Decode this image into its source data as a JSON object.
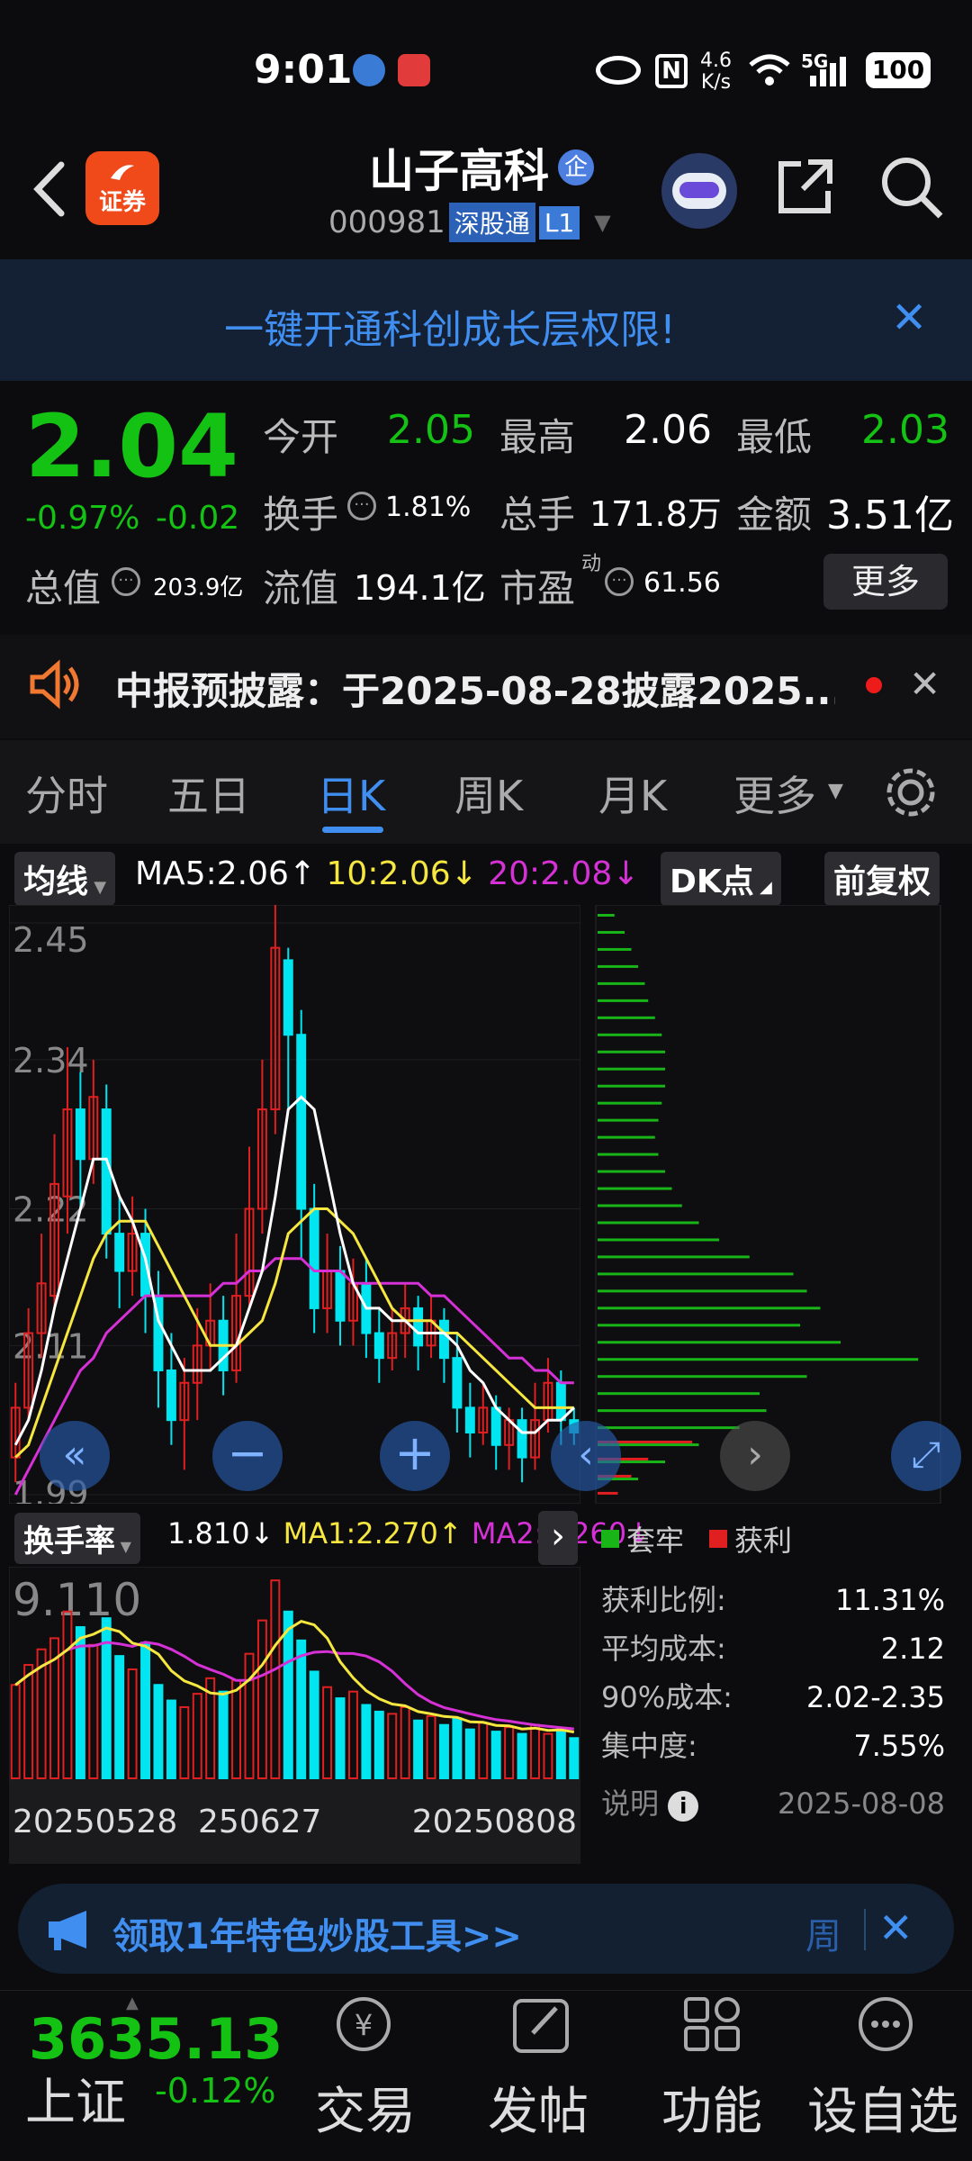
{
  "status": {
    "time": "9:01",
    "net_speed_top": "4.6",
    "net_speed_unit": "K/s",
    "battery": "100",
    "signal_label": "5G"
  },
  "header": {
    "back_icon": "chevron-left-icon",
    "app_logo_text": "证券",
    "stock_name": "山子高科",
    "enterprise_badge": "企",
    "stock_code": "000981",
    "market_tag": "深股通",
    "level_tag": "L1",
    "share_icon": "share-icon",
    "search_icon": "search-icon"
  },
  "banner": {
    "text": "一键开通科创成长层权限!",
    "close": "✕"
  },
  "quote": {
    "price": "2.04",
    "change_pct": "-0.97%",
    "change": "-0.02",
    "open_label": "今开",
    "open": "2.05",
    "high_label": "最高",
    "high": "2.06",
    "low_label": "最低",
    "low": "2.03",
    "turnover_label": "换手",
    "turnover": "1.81%",
    "volume_label": "总手",
    "volume": "171.8万",
    "amount_label": "金额",
    "amount": "3.51亿",
    "mktcap_label": "总值",
    "mktcap": "203.9亿",
    "float_label": "流值",
    "float_cap": "194.1亿",
    "pe_label": "市盈",
    "pe_sup": "动",
    "pe": "61.56",
    "more": "更多"
  },
  "notice": {
    "text": "中报预披露：于2025-08-28披露2025...",
    "close": "✕"
  },
  "tabs": [
    {
      "label": "分时"
    },
    {
      "label": "五日"
    },
    {
      "label": "日K",
      "active": true
    },
    {
      "label": "周K"
    },
    {
      "label": "月K"
    },
    {
      "label": "更多"
    }
  ],
  "chart_toolbar": {
    "ma_select": "均线",
    "ma5": "MA5:2.06",
    "ma5_arrow": "↑",
    "ma10": "10:2.06",
    "ma10_arrow": "↓",
    "ma20": "20:2.08",
    "ma20_arrow": "↓",
    "dk": "DK点",
    "adjust": "前复权"
  },
  "colors": {
    "up": "#e02020",
    "down": "#00e5f0",
    "ma5": "#ffffff",
    "ma10": "#f5e640",
    "ma20": "#d631d6",
    "green": "#14c214"
  },
  "chart_data": {
    "type": "candlestick",
    "y_ticks": [
      "2.45",
      "2.34",
      "2.22",
      "2.11",
      "1.99"
    ],
    "ylim": [
      1.99,
      2.45
    ],
    "x_ticks": [
      "20250528",
      "250627",
      "20250808"
    ],
    "candles": [
      [
        2.02,
        2.06,
        2.08,
        2.0
      ],
      [
        2.06,
        2.12,
        2.14,
        2.05
      ],
      [
        2.12,
        2.16,
        2.2,
        2.1
      ],
      [
        2.15,
        2.24,
        2.28,
        2.14
      ],
      [
        2.23,
        2.3,
        2.35,
        2.2
      ],
      [
        2.3,
        2.26,
        2.33,
        2.22
      ],
      [
        2.26,
        2.31,
        2.34,
        2.24
      ],
      [
        2.3,
        2.2,
        2.32,
        2.18
      ],
      [
        2.2,
        2.17,
        2.23,
        2.14
      ],
      [
        2.17,
        2.2,
        2.23,
        2.15
      ],
      [
        2.2,
        2.15,
        2.22,
        2.12
      ],
      [
        2.15,
        2.09,
        2.17,
        2.06
      ],
      [
        2.09,
        2.05,
        2.12,
        2.03
      ],
      [
        2.05,
        2.08,
        2.1,
        2.01
      ],
      [
        2.08,
        2.11,
        2.14,
        2.05
      ],
      [
        2.11,
        2.13,
        2.16,
        2.09
      ],
      [
        2.13,
        2.09,
        2.15,
        2.07
      ],
      [
        2.09,
        2.15,
        2.2,
        2.08
      ],
      [
        2.15,
        2.22,
        2.27,
        2.14
      ],
      [
        2.22,
        2.3,
        2.34,
        2.2
      ],
      [
        2.3,
        2.43,
        2.47,
        2.28
      ],
      [
        2.42,
        2.36,
        2.43,
        2.3
      ],
      [
        2.36,
        2.22,
        2.38,
        2.18
      ],
      [
        2.22,
        2.14,
        2.24,
        2.12
      ],
      [
        2.14,
        2.17,
        2.2,
        2.12
      ],
      [
        2.17,
        2.13,
        2.19,
        2.11
      ],
      [
        2.13,
        2.16,
        2.18,
        2.11
      ],
      [
        2.16,
        2.12,
        2.18,
        2.1
      ],
      [
        2.12,
        2.1,
        2.14,
        2.08
      ],
      [
        2.1,
        2.12,
        2.14,
        2.09
      ],
      [
        2.12,
        2.14,
        2.16,
        2.1
      ],
      [
        2.14,
        2.11,
        2.15,
        2.09
      ],
      [
        2.11,
        2.13,
        2.15,
        2.1
      ],
      [
        2.13,
        2.1,
        2.14,
        2.08
      ],
      [
        2.1,
        2.06,
        2.12,
        2.04
      ],
      [
        2.06,
        2.04,
        2.08,
        2.02
      ],
      [
        2.04,
        2.06,
        2.08,
        2.03
      ],
      [
        2.06,
        2.03,
        2.07,
        2.01
      ],
      [
        2.03,
        2.05,
        2.06,
        2.01
      ],
      [
        2.05,
        2.02,
        2.06,
        2.0
      ],
      [
        2.02,
        2.05,
        2.08,
        2.01
      ],
      [
        2.05,
        2.08,
        2.1,
        2.04
      ],
      [
        2.08,
        2.05,
        2.09,
        2.03
      ],
      [
        2.05,
        2.04,
        2.06,
        2.03
      ]
    ],
    "ma5": [
      2.03,
      2.05,
      2.09,
      2.14,
      2.18,
      2.22,
      2.26,
      2.26,
      2.23,
      2.21,
      2.18,
      2.13,
      2.11,
      2.09,
      2.09,
      2.09,
      2.1,
      2.11,
      2.14,
      2.17,
      2.23,
      2.3,
      2.31,
      2.3,
      2.25,
      2.2,
      2.16,
      2.14,
      2.14,
      2.13,
      2.13,
      2.12,
      2.12,
      2.12,
      2.11,
      2.09,
      2.08,
      2.06,
      2.05,
      2.04,
      2.04,
      2.05,
      2.05,
      2.06
    ],
    "ma10": [
      2.02,
      2.03,
      2.06,
      2.09,
      2.12,
      2.15,
      2.18,
      2.2,
      2.21,
      2.21,
      2.21,
      2.19,
      2.17,
      2.15,
      2.13,
      2.11,
      2.11,
      2.11,
      2.12,
      2.13,
      2.16,
      2.2,
      2.21,
      2.22,
      2.22,
      2.21,
      2.2,
      2.18,
      2.16,
      2.14,
      2.13,
      2.13,
      2.13,
      2.12,
      2.12,
      2.11,
      2.1,
      2.09,
      2.08,
      2.07,
      2.06,
      2.06,
      2.06,
      2.06
    ],
    "ma20": [
      1.99,
      2.01,
      2.03,
      2.05,
      2.07,
      2.09,
      2.1,
      2.12,
      2.13,
      2.14,
      2.15,
      2.15,
      2.15,
      2.15,
      2.15,
      2.15,
      2.16,
      2.16,
      2.17,
      2.17,
      2.18,
      2.18,
      2.18,
      2.17,
      2.17,
      2.17,
      2.16,
      2.16,
      2.16,
      2.16,
      2.16,
      2.16,
      2.15,
      2.15,
      2.14,
      2.13,
      2.12,
      2.11,
      2.1,
      2.1,
      2.09,
      2.09,
      2.08,
      2.08
    ],
    "turnover": {
      "label": "换手率",
      "value": "1.810",
      "value_arrow": "↓",
      "ma1": "MA1:2.270",
      "ma1_arrow": "↑",
      "ma2": "MA2:2.260",
      "ma2_arrow": "↓",
      "max_label": "9.110",
      "values": [
        4.2,
        5.1,
        5.8,
        6.3,
        7.5,
        6.8,
        6.0,
        7.2,
        5.5,
        4.9,
        6.1,
        4.2,
        3.5,
        3.2,
        3.8,
        4.5,
        3.9,
        4.4,
        5.6,
        7.1,
        8.9,
        7.5,
        6.2,
        4.8,
        4.1,
        3.6,
        3.9,
        3.3,
        3.0,
        2.9,
        3.2,
        2.6,
        2.8,
        2.4,
        2.7,
        2.2,
        2.5,
        2.1,
        2.3,
        2.0,
        2.4,
        2.0,
        2.2,
        1.81
      ]
    },
    "chips": {
      "legend_trap": "套牢",
      "legend_profit": "获利",
      "profit_ratio_label": "获利比例:",
      "profit_ratio": "11.31%",
      "avg_cost_label": "平均成本:",
      "avg_cost": "2.12",
      "cost90_label": "90%成本:",
      "cost90": "2.02-2.35",
      "concentration_label": "集中度:",
      "concentration": "7.55%",
      "note_label": "说明",
      "date": "2025-08-08",
      "bars": [
        0.05,
        0.08,
        0.1,
        0.12,
        0.14,
        0.15,
        0.17,
        0.19,
        0.2,
        0.2,
        0.2,
        0.19,
        0.18,
        0.17,
        0.18,
        0.2,
        0.22,
        0.25,
        0.3,
        0.36,
        0.45,
        0.58,
        0.62,
        0.66,
        0.6,
        0.72,
        0.95,
        0.62,
        0.48,
        0.5,
        0.42,
        0.3,
        0.2,
        0.12
      ]
    }
  },
  "promo": {
    "text": "领取1年特色炒股工具>>",
    "right": "周"
  },
  "bottom": {
    "index_value": "3635.13",
    "index_name": "上证",
    "index_change": "-0.12%",
    "trade": "交易",
    "post": "发帖",
    "func": "功能",
    "watch": "设自选"
  }
}
